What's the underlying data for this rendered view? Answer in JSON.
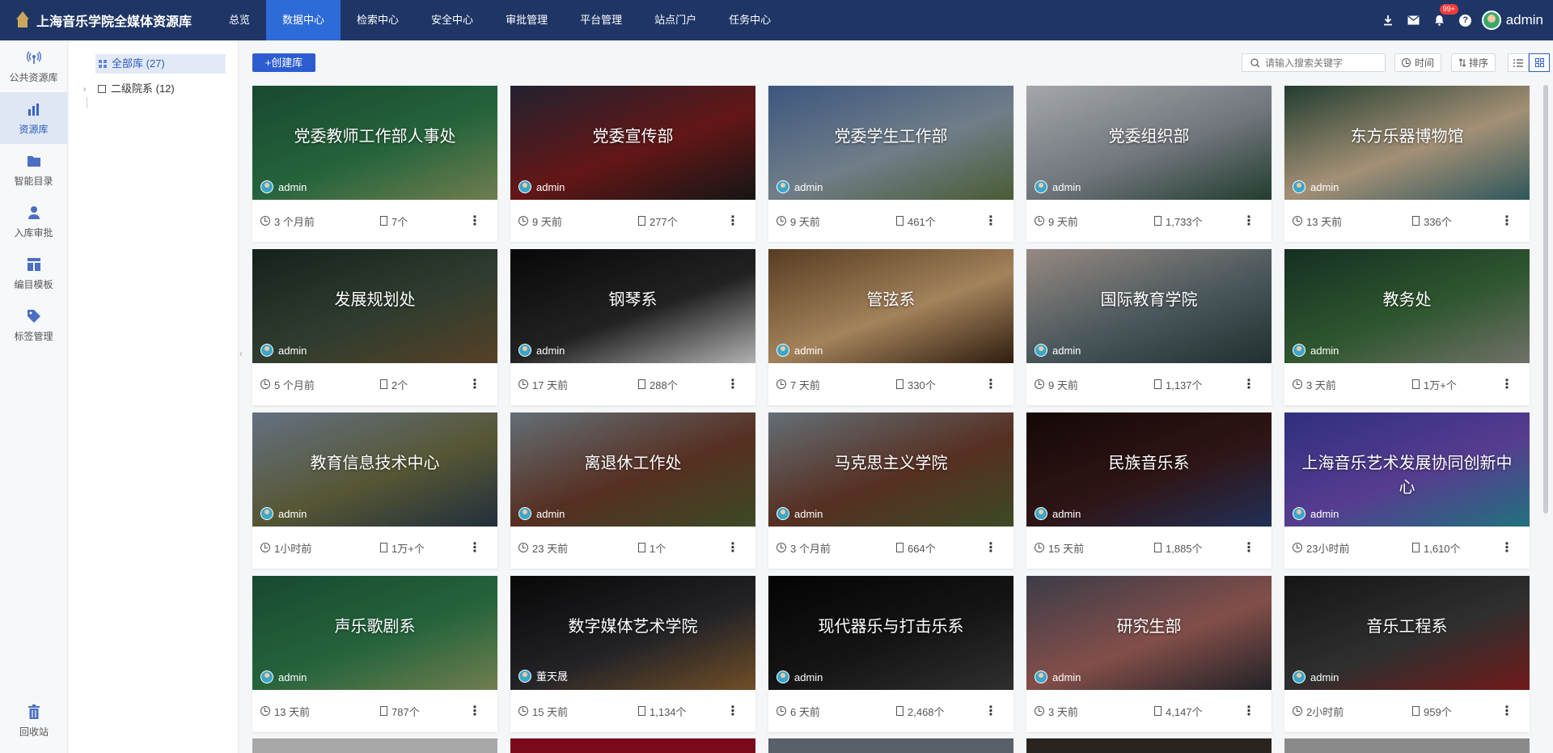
{
  "app": {
    "title": "上海音乐学院全媒体资源库"
  },
  "nav": [
    {
      "label": "总览",
      "active": false
    },
    {
      "label": "数据中心",
      "active": true
    },
    {
      "label": "检索中心",
      "active": false
    },
    {
      "label": "安全中心",
      "active": false
    },
    {
      "label": "审批管理",
      "active": false
    },
    {
      "label": "平台管理",
      "active": false
    },
    {
      "label": "站点门户",
      "active": false
    },
    {
      "label": "任务中心",
      "active": false
    }
  ],
  "header": {
    "notification_badge": "99+",
    "user_name": "admin",
    "help_glyph": "?"
  },
  "sidebar": [
    {
      "label": "公共资源库",
      "icon": "broadcast-icon"
    },
    {
      "label": "资源库",
      "icon": "bar-chart-icon",
      "active": true
    },
    {
      "label": "智能目录",
      "icon": "folder-icon"
    },
    {
      "label": "入库审批",
      "icon": "person-icon"
    },
    {
      "label": "编目模板",
      "icon": "template-icon"
    },
    {
      "label": "标签管理",
      "icon": "tag-icon"
    }
  ],
  "sidebar_bottom": {
    "label": "回收站",
    "icon": "trash-icon"
  },
  "tree": {
    "all": "全部库 (27)",
    "secondary": "二级院系 (12)"
  },
  "toolbar": {
    "create_label": "+创建库",
    "search_placeholder": "请输入搜索关键字",
    "time_label": "时间",
    "sort_label": "排序"
  },
  "cards": [
    {
      "title": "党委教师工作部人事处",
      "owner": "admin",
      "time": "3 个月前",
      "count": "7个",
      "colors": [
        "#1d5a3a",
        "#2e7a4a",
        "#8a9a60"
      ]
    },
    {
      "title": "党委宣传部",
      "owner": "admin",
      "time": "9 天前",
      "count": "277个",
      "colors": [
        "#2a2a3a",
        "#7a1c1c",
        "#1a1a1a"
      ]
    },
    {
      "title": "党委学生工作部",
      "owner": "admin",
      "time": "9 天前",
      "count": "461个",
      "colors": [
        "#4a6a9a",
        "#8a9aa8",
        "#5a7040"
      ]
    },
    {
      "title": "党委组织部",
      "owner": "admin",
      "time": "9 天前",
      "count": "1,733个",
      "colors": [
        "#c8ccd0",
        "#8a9098",
        "#2a4a3a"
      ]
    },
    {
      "title": "东方乐器博物馆",
      "owner": "admin",
      "time": "13 天前",
      "count": "336个",
      "colors": [
        "#2a4a3a",
        "#c8b090",
        "#3a6a70"
      ]
    },
    {
      "title": "发展规划处",
      "owner": "admin",
      "time": "5 个月前",
      "count": "2个",
      "colors": [
        "#1a2a22",
        "#3a4a3a",
        "#6a5030"
      ]
    },
    {
      "title": "钢琴系",
      "owner": "admin",
      "time": "17 天前",
      "count": "288个",
      "colors": [
        "#0a0a0a",
        "#2a2a2a",
        "#d8d8d8"
      ]
    },
    {
      "title": "管弦系",
      "owner": "admin",
      "time": "7 天前",
      "count": "330个",
      "colors": [
        "#6a4a2a",
        "#c8a070",
        "#3a2414"
      ]
    },
    {
      "title": "国际教育学院",
      "owner": "admin",
      "time": "9 天前",
      "count": "1,137个",
      "colors": [
        "#b8a8a0",
        "#5a6a70",
        "#2a3a3a"
      ]
    },
    {
      "title": "教务处",
      "owner": "admin",
      "time": "3 天前",
      "count": "1万+个",
      "colors": [
        "#1a3a2a",
        "#3a6a3a",
        "#8a8a80"
      ]
    },
    {
      "title": "教育信息技术中心",
      "owner": "admin",
      "time": "1小时前",
      "count": "1万+个",
      "colors": [
        "#7a8aa0",
        "#6a6a40",
        "#2a3a4a"
      ]
    },
    {
      "title": "离退休工作处",
      "owner": "admin",
      "time": "23 天前",
      "count": "1个",
      "colors": [
        "#7a8890",
        "#6a3a2a",
        "#4a5a30"
      ]
    },
    {
      "title": "马克思主义学院",
      "owner": "admin",
      "time": "3 个月前",
      "count": "664个",
      "colors": [
        "#7a8890",
        "#6a3a2a",
        "#4a5a30"
      ]
    },
    {
      "title": "民族音乐系",
      "owner": "admin",
      "time": "15 天前",
      "count": "1,885个",
      "colors": [
        "#1a0a0a",
        "#3a1a1a",
        "#2a3a6a"
      ]
    },
    {
      "title": "上海音乐艺术发展协同创新中心",
      "owner": "admin",
      "time": "23小时前",
      "count": "1,610个",
      "colors": [
        "#3a3a9a",
        "#6a4ab0",
        "#2a8a9a"
      ]
    },
    {
      "title": "声乐歌剧系",
      "owner": "admin",
      "time": "13 天前",
      "count": "787个",
      "colors": [
        "#1d5a3a",
        "#2e7a4a",
        "#8a9a60"
      ]
    },
    {
      "title": "数字媒体艺术学院",
      "owner": "董天晟",
      "time": "15 天前",
      "count": "1,134个",
      "colors": [
        "#0a0a0a",
        "#2a2a30",
        "#8a6030"
      ]
    },
    {
      "title": "现代器乐与打击乐系",
      "owner": "admin",
      "time": "6 天前",
      "count": "2,468个",
      "colors": [
        "#050505",
        "#1a1a1a",
        "#3a3a3a"
      ]
    },
    {
      "title": "研究生部",
      "owner": "admin",
      "time": "3 天前",
      "count": "4,147个",
      "colors": [
        "#4a4a58",
        "#a0605a",
        "#2a2a30"
      ]
    },
    {
      "title": "音乐工程系",
      "owner": "admin",
      "time": "2小时前",
      "count": "959个",
      "colors": [
        "#1a1a1a",
        "#3a3a3a",
        "#8a2020"
      ]
    }
  ],
  "partial_colors": [
    "#a8a8a8",
    "#7a0a1a",
    "#5a6068",
    "#2a2420",
    "#8a8a8a"
  ]
}
